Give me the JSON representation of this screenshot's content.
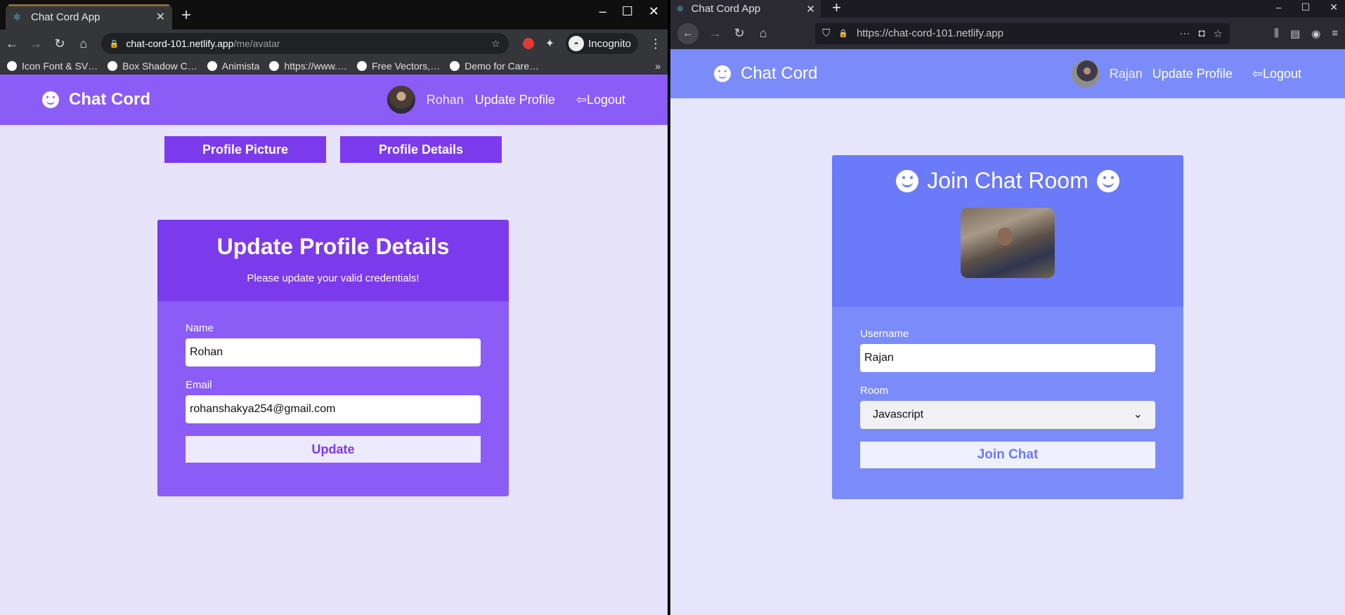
{
  "left_browser": {
    "tab_title": "Chat Cord App",
    "url_host": "chat-cord-101.netlify.app",
    "url_path": "/me/avatar",
    "incognito_label": "Incognito",
    "bookmarks": [
      "Icon Font & SV…",
      "Box Shadow C…",
      "Animista",
      "https://www.…",
      "Free Vectors,…",
      "Demo for Care…"
    ],
    "page": {
      "brand": "Chat Cord",
      "user_name": "Rohan",
      "update_profile": "Update Profile",
      "logout": "Logout",
      "tab_profile_picture": "Profile Picture",
      "tab_profile_details": "Profile Details",
      "card_title": "Update Profile Details",
      "card_subtitle": "Please update your valid credentials!",
      "name_label": "Name",
      "name_value": "Rohan",
      "email_label": "Email",
      "email_value": "rohanshakya254@gmail.com",
      "update_button": "Update"
    }
  },
  "right_browser": {
    "tab_title": "Chat Cord App",
    "url": "https://chat-cord-101.netlify.app",
    "page": {
      "brand": "Chat Cord",
      "user_name": "Rajan",
      "update_profile": "Update Profile",
      "logout": "Logout",
      "card_title": "Join Chat Room",
      "username_label": "Username",
      "username_value": "Rajan",
      "room_label": "Room",
      "room_value": "Javascript",
      "join_button": "Join Chat"
    }
  },
  "colors": {
    "left_accent": "#8b5cf6",
    "left_accent_dark": "#7c3aed",
    "right_accent": "#7b8cfa",
    "page_bg": "#e7e3fa"
  }
}
